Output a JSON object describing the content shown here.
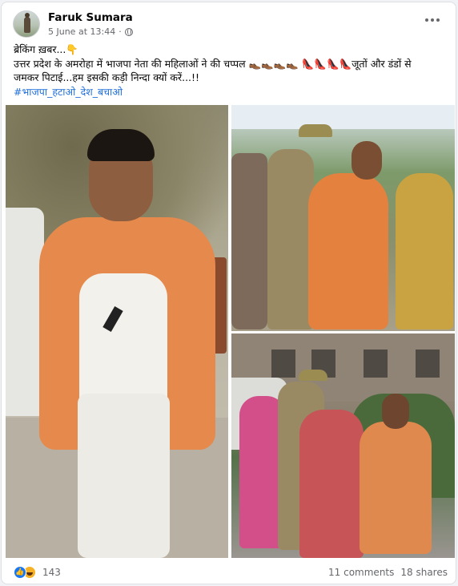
{
  "post": {
    "author": "Faruk Sumara",
    "timestamp": "5 June at 13:44",
    "privacy_icon": "globe-icon",
    "text_lines": [
      "ब्रेकिंग ख़बर...👇",
      "उत्तर प्रदेश के अमरोहा में भाजपा नेता की महिलाओं ने की चप्पल 👞👞👞👞 👠👠👠👠जूतों और डंडों से",
      "जमकर पिटाई...हम इसकी कड़ी निन्दा क्यों करें...!!"
    ],
    "hashtag": "#भाजपा_हटाओ_देश_बचाओ"
  },
  "footer": {
    "reaction_count": "143",
    "comments": "11 comments",
    "shares": "18 shares"
  },
  "colors": {
    "link": "#216fdb",
    "like": "#1877f2",
    "meta_text": "#65676b"
  }
}
